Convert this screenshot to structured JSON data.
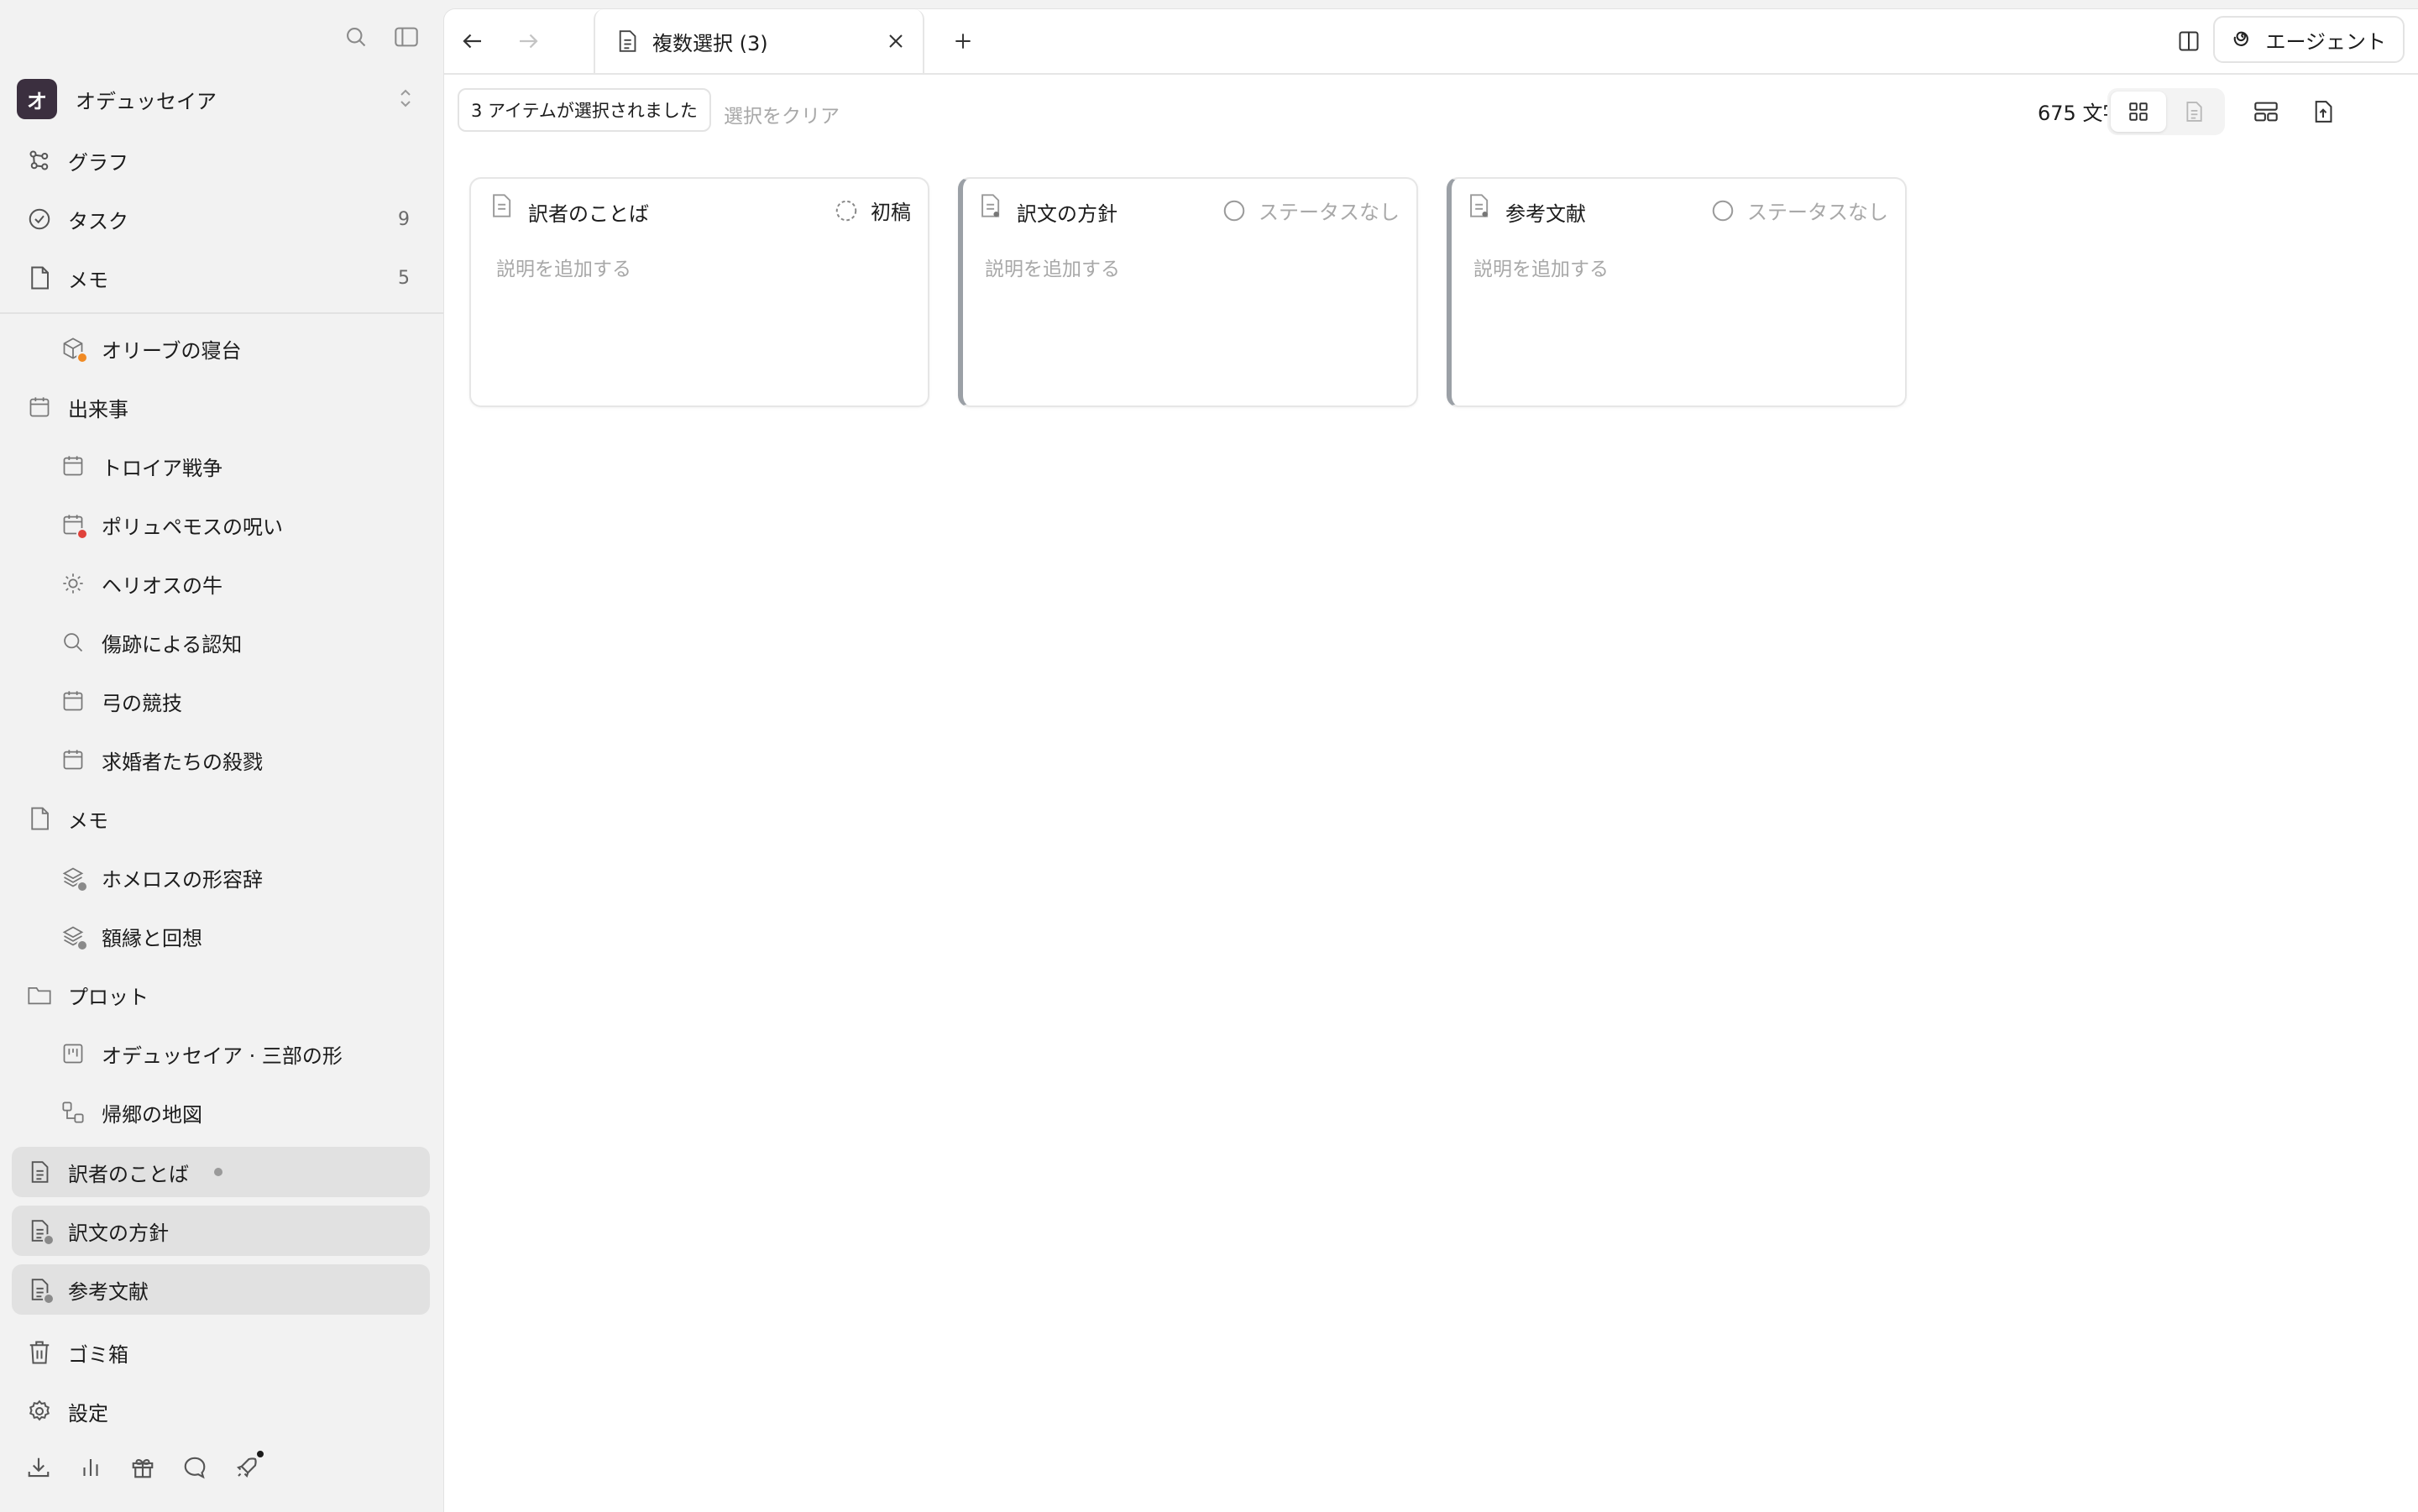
{
  "sidebar": {
    "workspace": {
      "initial": "オ",
      "name": "オデュッセイア"
    },
    "top_nav": [
      {
        "label": "グラフ",
        "icon": "graph-icon"
      },
      {
        "label": "タスク",
        "icon": "task-check-icon",
        "count": "9"
      },
      {
        "label": "メモ",
        "icon": "memo-page-icon",
        "count": "5"
      }
    ],
    "tree": [
      {
        "label": "オリーブの寝台",
        "icon": "cube-icon",
        "level": 1,
        "badge": "#f08a24"
      },
      {
        "label": "出来事",
        "icon": "calendar-icon",
        "level": 0
      },
      {
        "label": "トロイア戦争",
        "icon": "calendar-icon",
        "level": 1
      },
      {
        "label": "ポリュペモスの呪い",
        "icon": "calendar-icon",
        "level": 1,
        "badge": "#e0423b"
      },
      {
        "label": "ヘリオスの牛",
        "icon": "sun-icon",
        "level": 1
      },
      {
        "label": "傷跡による認知",
        "icon": "search-icon",
        "level": 1
      },
      {
        "label": "弓の競技",
        "icon": "calendar-icon",
        "level": 1
      },
      {
        "label": "求婚者たちの殺戮",
        "icon": "calendar-icon",
        "level": 1
      },
      {
        "label": "メモ",
        "icon": "page-icon",
        "level": 0
      },
      {
        "label": "ホメロスの形容辞",
        "icon": "layers-icon",
        "level": 1,
        "badge": "#8a8a8a"
      },
      {
        "label": "額縁と回想",
        "icon": "layers-icon",
        "level": 1,
        "badge": "#8a8a8a"
      },
      {
        "label": "プロット",
        "icon": "folder-icon",
        "level": 0
      },
      {
        "label": "オデュッセイア · 三部の形",
        "icon": "board-icon",
        "level": 1
      },
      {
        "label": "帰郷の地図",
        "icon": "flow-icon",
        "level": 1
      }
    ],
    "selected": [
      {
        "label": "訳者のことば",
        "icon": "document-icon",
        "dot": true
      },
      {
        "label": "訳文の方針",
        "icon": "document-icon"
      },
      {
        "label": "参考文献",
        "icon": "document-icon"
      }
    ],
    "trash_label": "ゴミ箱",
    "settings_label": "設定"
  },
  "tabbar": {
    "tab_label": "複数選択 (3)",
    "agent_label": "エージェント"
  },
  "toolbar": {
    "selection_label": "3 アイテムが選択されました",
    "clear_label": "選択をクリア",
    "word_count": "675 文字"
  },
  "cards": [
    {
      "title": "訳者のことば",
      "status": "初稿",
      "status_style": "dashed",
      "description": "説明を追加する"
    },
    {
      "title": "訳文の方針",
      "status": "ステータスなし",
      "status_style": "empty",
      "description": "説明を追加する"
    },
    {
      "title": "参考文献",
      "status": "ステータスなし",
      "status_style": "empty",
      "description": "説明を追加する"
    }
  ],
  "colors": {
    "accent_border": "#9ba0a6",
    "workspace_avatar": "#3b2f3f",
    "selected_bg": "#e1e1e1"
  }
}
